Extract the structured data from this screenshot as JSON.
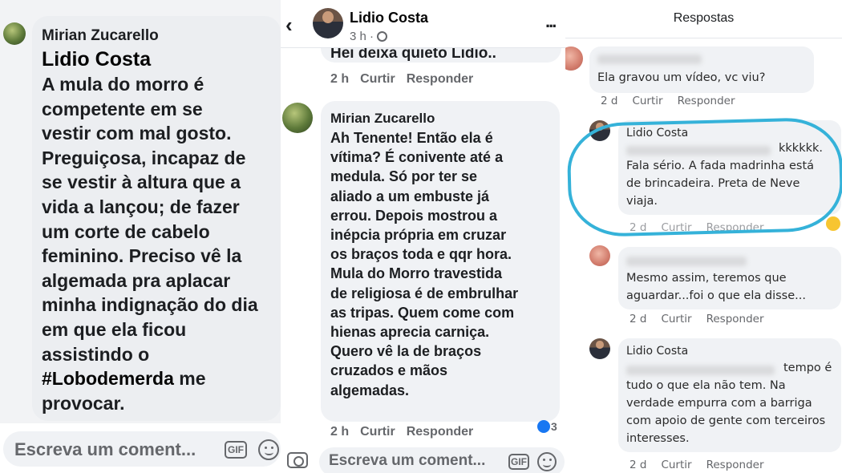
{
  "panel1": {
    "commenter": "Mirian Zucarello",
    "tagged": "Lidio Costa",
    "comment_lines": [
      "A mula do morro é",
      "competente em se",
      "vestir com mal gosto.",
      "Preguiçosa, incapaz de",
      "se vestir à altura que a",
      "vida a lançou; de fazer",
      "um corte de cabelo",
      "feminino. Preciso vê la",
      "algemada pra aplacar",
      "minha indignação do dia",
      "em que ela ficou",
      "assistindo o"
    ],
    "hashtag": "#Lobodemerda",
    "after_hashtag": " me",
    "last_line": "provocar.",
    "compose_placeholder": "Escreva um coment...",
    "gif_label": "GIF"
  },
  "panel2": {
    "back_icon": "chevron-left",
    "poster": "Lidio Costa",
    "time": "3 h ·",
    "more_label": "...",
    "prev_comment_fragment": "Hei deixa quieto Lidio..",
    "prev_meta": {
      "time": "2 h",
      "like": "Curtir",
      "reply": "Responder"
    },
    "commenter": "Mirian Zucarello",
    "comment_lines": [
      "Ah Tenente! Então ela é",
      "vítima? É conivente até a",
      "medula. Só por ter se",
      "aliado a um embuste já",
      "errou. Depois mostrou a",
      "inépcia própria em cruzar",
      "os braços toda e qqr hora.",
      "Mula do Morro travestida",
      "de religiosa é de embrulhar",
      "as tripas. Quem come com",
      "hienas aprecia carniça.",
      "Quero vê la de braços",
      "cruzados e mãos",
      "algemadas."
    ],
    "reaction_count": "3",
    "meta": {
      "time": "2 h",
      "like": "Curtir",
      "reply": "Responder"
    },
    "compose_placeholder": "Escreva um coment...",
    "gif_label": "GIF"
  },
  "panel3": {
    "title": "Respostas",
    "replies": [
      {
        "name": "",
        "lines": [
          "Ela gravou um vídeo, vc viu?"
        ],
        "meta": {
          "time": "2 d",
          "like": "Curtir",
          "reply": "Responder"
        }
      },
      {
        "name": "Lidio Costa",
        "lines": [
          "kkkkkk.",
          "Fala sério. A fada madrinha está",
          "de brincadeira. Preta de Neve",
          "viaja."
        ],
        "meta": {
          "time": "2 d",
          "like": "Curtir",
          "reply": "Responder"
        }
      },
      {
        "name": "",
        "lines": [
          "Mesmo assim, teremos que",
          "aguardar...foi o que ela disse..."
        ],
        "meta": {
          "time": "2 d",
          "like": "Curtir",
          "reply": "Responder"
        }
      },
      {
        "name": "Lidio Costa",
        "lines": [
          "tempo é",
          "tudo o que ela não tem. Na",
          "verdade empurra com a barriga",
          "com apoio de gente com terceiros",
          "interesses."
        ],
        "meta": {
          "time": "2 d",
          "like": "Curtir",
          "reply": "Responder"
        }
      }
    ],
    "highlight_color": "#35b2d9"
  }
}
